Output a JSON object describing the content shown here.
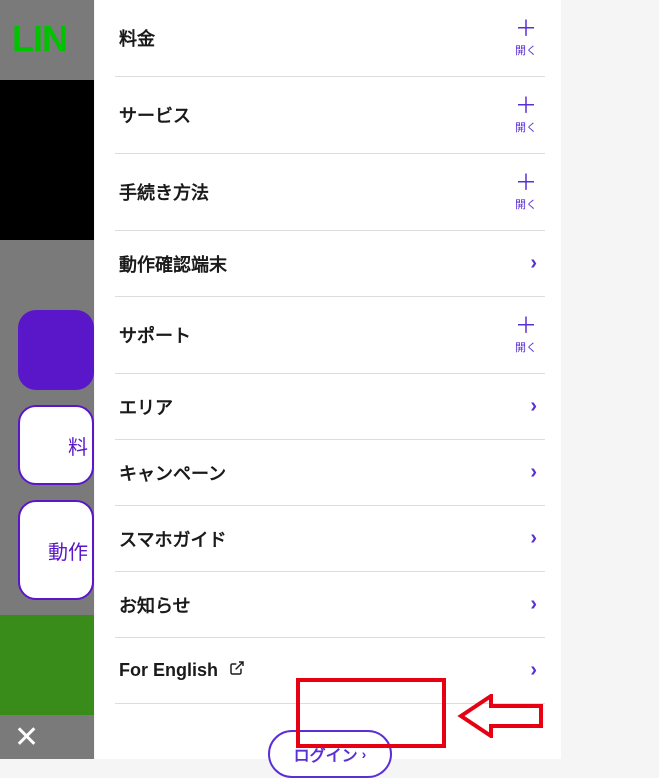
{
  "logo_fragment": "LIN",
  "close_label": "閉じる",
  "menu": {
    "open_label": "開く",
    "items": [
      {
        "label": "料金",
        "kind": "expand"
      },
      {
        "label": "サービス",
        "kind": "expand"
      },
      {
        "label": "手続き方法",
        "kind": "expand"
      },
      {
        "label": "動作確認端末",
        "kind": "link"
      },
      {
        "label": "サポート",
        "kind": "expand"
      },
      {
        "label": "エリア",
        "kind": "link"
      },
      {
        "label": "キャンペーン",
        "kind": "link"
      },
      {
        "label": "スマホガイド",
        "kind": "link"
      },
      {
        "label": "お知らせ",
        "kind": "link"
      },
      {
        "label": "For English",
        "kind": "external"
      }
    ]
  },
  "login_label": "ログイン",
  "bg_hint_1": "料",
  "bg_hint_2": "動作"
}
